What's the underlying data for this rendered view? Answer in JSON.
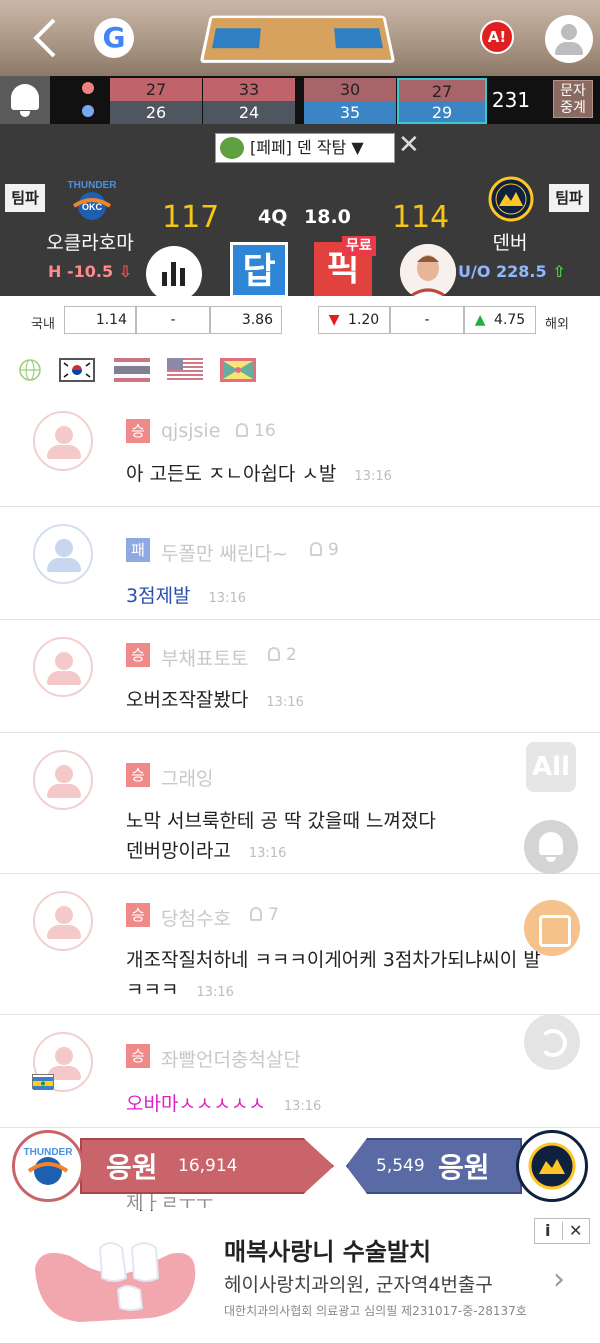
{
  "topbar": {
    "alert_label": "A!"
  },
  "quarters": {
    "away": [
      "27",
      "33",
      "30",
      "27"
    ],
    "home": [
      "26",
      "24",
      "35",
      "29"
    ],
    "total": "231"
  },
  "sms_button": {
    "line1": "문자",
    "line2": "중계"
  },
  "room": {
    "label": "[페페] 덴 작탐 ▼",
    "close": "✕"
  },
  "match": {
    "tippa_label": "팀파",
    "away_name": "오클라호마",
    "home_name": "덴버",
    "away_score": "117",
    "home_score": "114",
    "quarter": "4Q",
    "clock": "18.0",
    "handicap": "H -10.5",
    "over_under": "U/O 228.5",
    "answer_label": "답",
    "pick_label": "픽",
    "free_label": "무료",
    "away_logo_text": "THUNDER",
    "home_logo_text": "DENVER"
  },
  "odds": {
    "domestic_label": "국내",
    "overseas_label": "해외",
    "domestic": [
      "1.14",
      "-",
      "3.86"
    ],
    "overseas": [
      "1.20",
      "-",
      "4.75"
    ]
  },
  "flags": [
    "globe-icon",
    "korea-flag",
    "thailand-flag",
    "usa-flag",
    "grenada-flag"
  ],
  "chat": [
    {
      "badge": "승",
      "nick": "qjsjsie",
      "likes": "16",
      "msg": "아 고든도 ㅈㄴ아쉽다 ㅅ발",
      "time": "13:16"
    },
    {
      "badge": "패",
      "nick": "두폴만 쌔린다~",
      "likes": "9",
      "msg": "3점제발",
      "time": "13:16"
    },
    {
      "badge": "승",
      "nick": "부채표토토",
      "likes": "2",
      "msg": "오버조작잘봤다",
      "time": "13:16"
    },
    {
      "badge": "승",
      "nick": "그래잉",
      "likes": "",
      "msg_line1": "노막 서브룩한테 공 딱 갔을때 느껴졌다",
      "msg": "덴버망이라고",
      "time": "13:16"
    },
    {
      "badge": "승",
      "nick": "당첨수호",
      "likes": "7",
      "msg_line1": "개조작질처하네 ㅋㅋㅋ이게어케 3점차가되냐씨이 발",
      "msg": "ㅋㅋㅋ",
      "time": "13:16"
    },
    {
      "badge": "승",
      "nick": "좌빨언더충척살단",
      "likes": "",
      "msg": "오바마ㅅㅅㅅㅅㅅ",
      "time": "13:16"
    }
  ],
  "partial_msg": "제ㅏㄹㅜㅜ",
  "floating": {
    "all_label": "All"
  },
  "cheer": {
    "word": "응원",
    "away_count": "16,914",
    "home_count": "5,549"
  },
  "ad": {
    "title": "매복사랑니 수술발치",
    "subtitle": "헤이사랑치과의원, 군자역4번출구",
    "legal": "대한치과의사협회 의료광고 심의필 제231017-중-28137호",
    "info": "i",
    "close": "✕",
    "arrow": "›"
  },
  "colors": {
    "win_badge": "#f08a8a",
    "lose_badge": "#8fa9e4",
    "score": "#f5c518",
    "answer_btn": "#2f86d6",
    "pick_btn": "#e2423e",
    "msg_blue": "#2a4db0",
    "msg_magenta": "#e020c0"
  }
}
